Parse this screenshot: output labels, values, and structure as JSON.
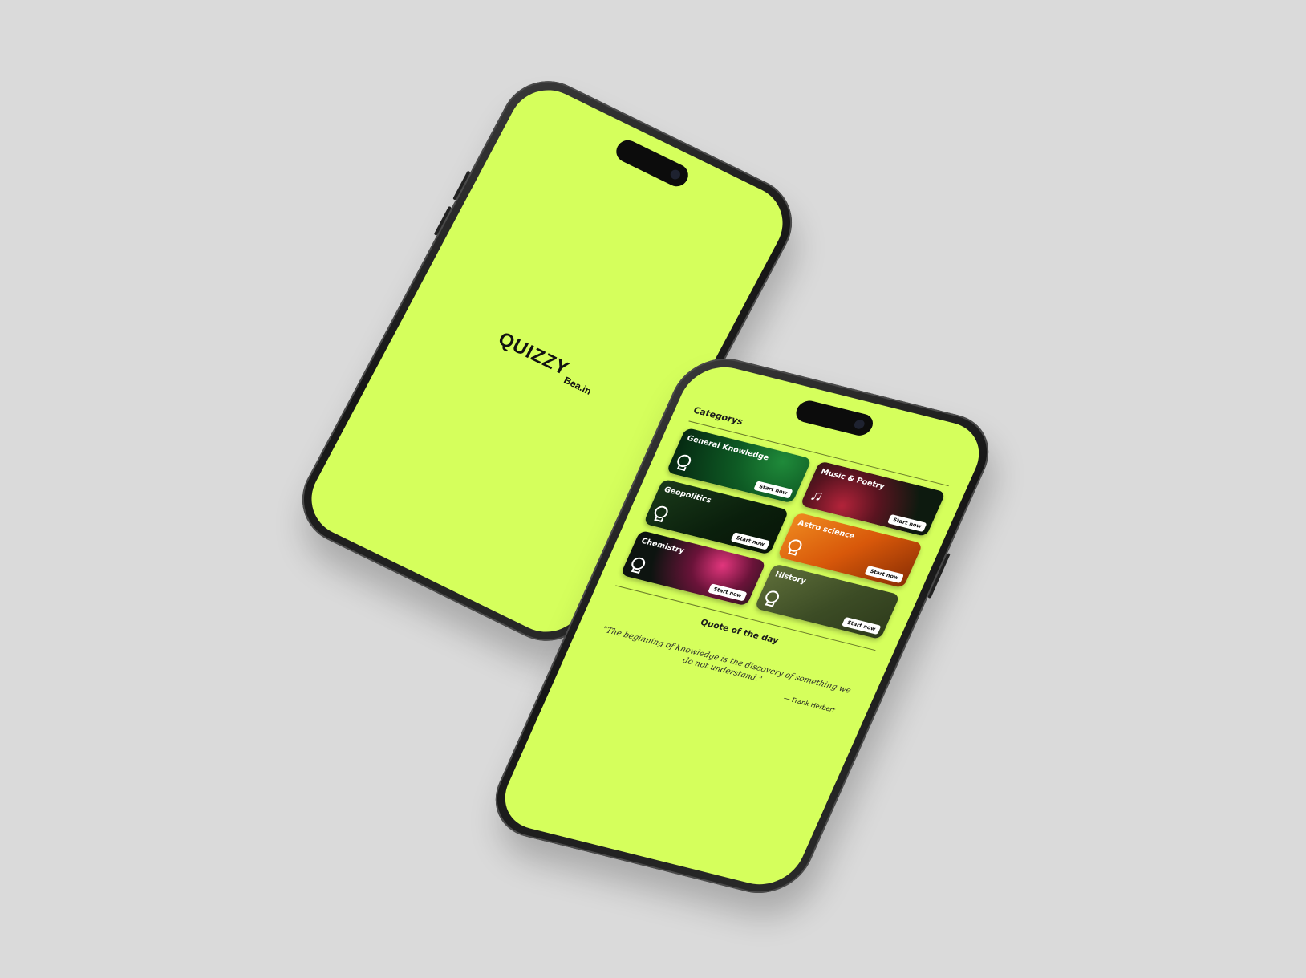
{
  "splash": {
    "logo": "QUIZZY",
    "logo_sub": "Bea.in"
  },
  "home": {
    "categories_title": "Categorys",
    "categories": [
      {
        "title": "General Knowledge",
        "button": "Start now",
        "icon": "lightbulb-icon"
      },
      {
        "title": "Music & Poetry",
        "button": "Start now",
        "icon": "music-note-icon"
      },
      {
        "title": "Geopolitics",
        "button": "Start now",
        "icon": "lightbulb-icon"
      },
      {
        "title": "Astro science",
        "button": "Start now",
        "icon": "lightbulb-icon"
      },
      {
        "title": "Chemistry",
        "button": "Start now",
        "icon": "lightbulb-icon"
      },
      {
        "title": "History",
        "button": "Start now",
        "icon": "lightbulb-icon"
      }
    ],
    "quote_title": "Quote of the day",
    "quote_text": "\"The beginning of knowledge is the discovery of something we do not understand.\"",
    "quote_author": "— Frank Herbert"
  },
  "colors": {
    "screen_bg": "#d5ff5c",
    "page_bg": "#dadada",
    "phone_frame": "#161616"
  }
}
